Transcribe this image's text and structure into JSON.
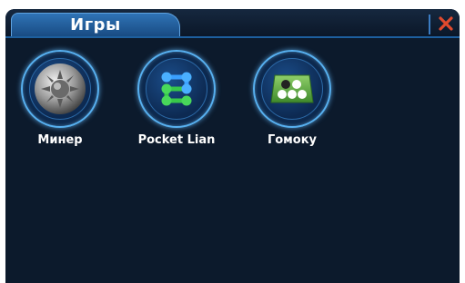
{
  "window": {
    "tab_title": "Игры"
  },
  "apps": [
    {
      "label": "Минер",
      "icon": "minesweeper-mine-icon"
    },
    {
      "label": "Pocket Lian",
      "icon": "connected-dots-icon"
    },
    {
      "label": "Гомоку",
      "icon": "gomoku-board-icon"
    }
  ],
  "colors": {
    "background": "#0c1a2c",
    "tab_accent": "#2f73b6",
    "ring_glow": "#57b0f0",
    "close": "#e04a2e"
  },
  "icons": {
    "close": "close-icon"
  }
}
